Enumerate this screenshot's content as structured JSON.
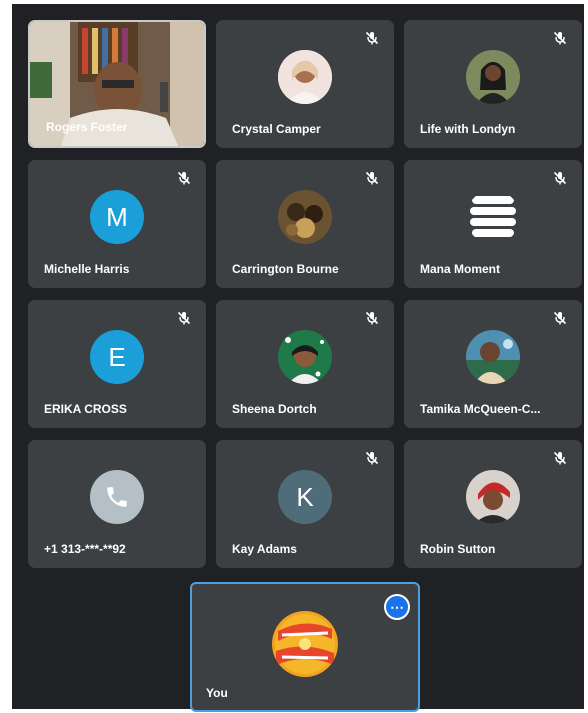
{
  "participants": [
    {
      "name": "Rogers Foster",
      "type": "video",
      "muted": false
    },
    {
      "name": "Crystal Camper",
      "type": "photo",
      "muted": true,
      "color": "#e9d5cf"
    },
    {
      "name": "Life with Londyn",
      "type": "photo",
      "muted": true,
      "color": "#6a7a5a"
    },
    {
      "name": "Michelle Harris",
      "type": "letter",
      "letter": "M",
      "muted": true
    },
    {
      "name": "Carrington Bourne",
      "type": "photo",
      "muted": true,
      "color": "#6b5230"
    },
    {
      "name": "Mana Moment",
      "type": "logo",
      "muted": true
    },
    {
      "name": "ERIKA CROSS",
      "type": "letter",
      "letter": "E",
      "muted": true
    },
    {
      "name": "Sheena Dortch",
      "type": "photo",
      "muted": true,
      "color": "#1f7a4a"
    },
    {
      "name": "Tamika McQueen-C...",
      "type": "photo",
      "muted": true,
      "color": "#4f8fb0"
    },
    {
      "name": "+1 313-***-**92",
      "type": "phone",
      "muted": false
    },
    {
      "name": "Kay Adams",
      "type": "letter",
      "letter": "K",
      "muted": true
    },
    {
      "name": "Robin Sutton",
      "type": "photo",
      "muted": true,
      "color": "#b83838"
    }
  ],
  "self": {
    "name": "You",
    "more_icon": "more-horizontal-icon"
  },
  "colors": {
    "stage": "#202124",
    "tile": "#3c4043",
    "accent": "#1a73e8"
  }
}
